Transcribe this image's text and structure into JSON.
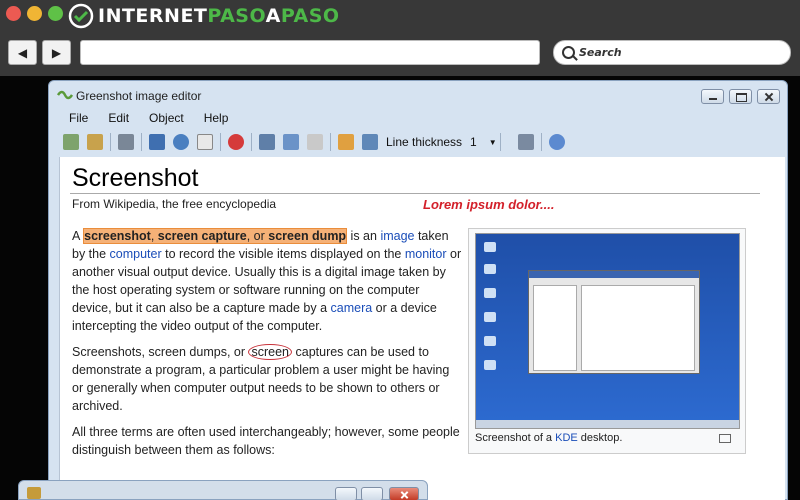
{
  "browser": {
    "logo": {
      "part_a": "INTERNET",
      "part_b": "PASO",
      "part_c": "A",
      "part_d": "PASO"
    },
    "nav": {
      "back_glyph": "◀",
      "forward_glyph": "▶"
    },
    "search": {
      "placeholder": "Search"
    }
  },
  "editor": {
    "title": "Greenshot image editor",
    "menu": [
      "File",
      "Edit",
      "Object",
      "Help"
    ],
    "toolbar": {
      "line_thickness_label": "Line thickness",
      "line_thickness_value": "1",
      "dropdown_glyph": "▼"
    }
  },
  "article": {
    "title": "Screenshot",
    "subtitle": "From Wikipedia, the free encyclopedia",
    "annotation": "Lorem ipsum dolor....",
    "p1": {
      "a": "A ",
      "h1": "screenshot",
      "h_sep1": ", ",
      "h2": "screen capture",
      "h_sep2": ", or ",
      "h3": "screen dump",
      "b": " is an ",
      "link_image": "image",
      "c": " taken by the ",
      "link_computer": "computer",
      "d": " to record the visible items displayed on the ",
      "link_monitor": "monitor",
      "e": " or another visual output device. Usually this is a digital image taken by the host operating system or software running on the computer device, but it can also be a capture made by a ",
      "link_camera": "camera",
      "f": " or a device intercepting the video output of the computer."
    },
    "p2": {
      "a": "Screenshots, screen dumps, or ",
      "circled": "screen",
      "b": " captures can be used to demonstrate a program, a particular problem a user might be having or generally when computer output needs to be shown to others or archived."
    },
    "p3": "All three terms are often used interchangeably; however, some people distinguish between them as follows:",
    "caption": {
      "a": "Screenshot of a ",
      "link": "KDE",
      "b": " desktop."
    }
  },
  "colors": {
    "highlight": "#f5b177",
    "annotation": "#d3202a",
    "link": "#1a4db8",
    "brand_green": "#4db848"
  },
  "icons": {
    "toolbar": [
      "copy-icon",
      "paste-icon",
      "print-icon",
      "rectangle-icon",
      "ellipse-icon",
      "crop-icon",
      "delete-icon",
      "cut-icon",
      "copy-icon",
      "paste-icon",
      "export-icon",
      "object-icon",
      "wrench-icon",
      "help-icon"
    ]
  }
}
